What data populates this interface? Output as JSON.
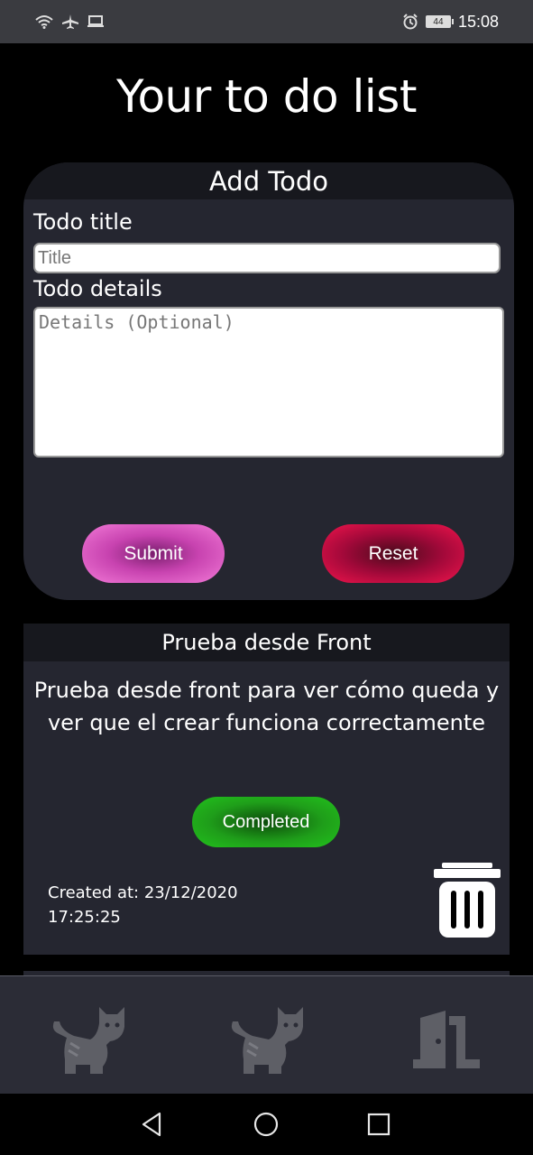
{
  "status_bar": {
    "time": "15:08",
    "battery": "44"
  },
  "page": {
    "title": "Your to do list"
  },
  "add_todo": {
    "header": "Add Todo",
    "title_label": "Todo title",
    "title_placeholder": "Title",
    "title_value": "",
    "details_label": "Todo details",
    "details_placeholder": "Details (Optional)",
    "details_value": "",
    "submit_label": "Submit",
    "reset_label": "Reset"
  },
  "todos": [
    {
      "title": "Prueba desde Front",
      "details": "Prueba desde front para ver cómo queda y ver que el crear funciona correctamente",
      "status_label": "Completed",
      "created_at": "Created at: 23/12/2020 17:25:25"
    }
  ],
  "bottom_nav": {
    "items": [
      {
        "icon": "cat-icon"
      },
      {
        "icon": "cat-icon"
      },
      {
        "icon": "logout-door-icon"
      }
    ]
  },
  "system_nav": {
    "icons": [
      "back-icon",
      "home-icon",
      "recents-icon"
    ]
  },
  "colors": {
    "background": "#000000",
    "card": "#252630",
    "card_header": "#17181e",
    "submit": "#f27ad7",
    "reset": "#f0144c",
    "completed": "#22c21c",
    "nav_icon": "#5e5f66"
  }
}
